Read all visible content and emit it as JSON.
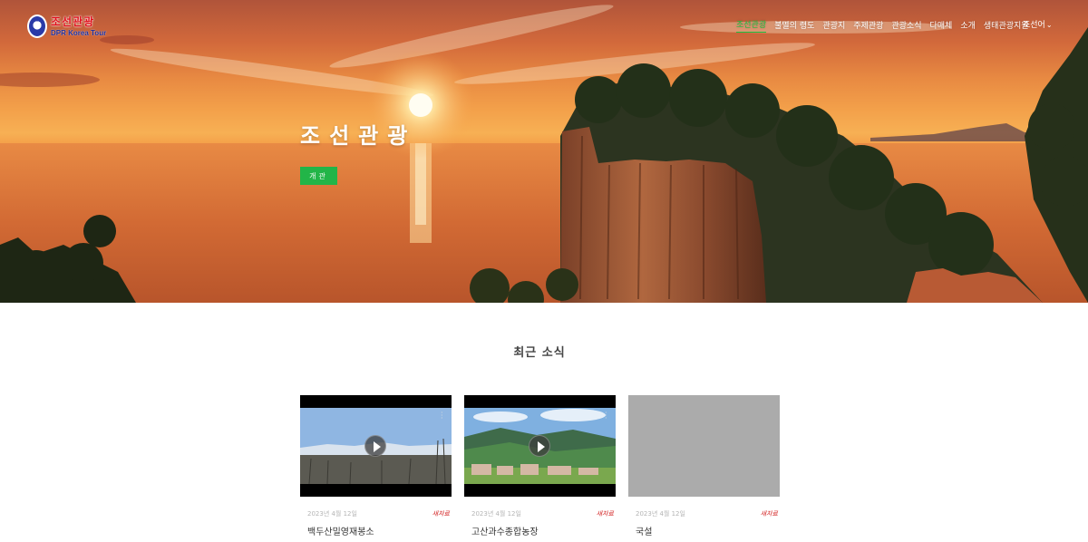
{
  "brand": {
    "logo_korean": "조선관광",
    "logo_english": "DPR Korea Tour"
  },
  "nav": {
    "items": [
      {
        "label": "조선관광",
        "active": true
      },
      {
        "label": "불멸의 령도",
        "active": false
      },
      {
        "label": "관광지",
        "active": false
      },
      {
        "label": "주제관광",
        "active": false
      },
      {
        "label": "관광소식",
        "active": false
      },
      {
        "label": "다매체",
        "active": false
      },
      {
        "label": "소개",
        "active": false
      },
      {
        "label": "생태관광지원",
        "active": false
      }
    ],
    "language": "조선어",
    "active_color": "#1fbf3f"
  },
  "hero": {
    "title": "조선관광",
    "button_label": "개관",
    "button_color": "#22b548"
  },
  "news": {
    "section_title": "최근 소식",
    "cards": [
      {
        "date": "2023년 4월 12일",
        "badge": "새자료",
        "title": "백두산밀영재봉소",
        "media": "video",
        "icon": "play-icon"
      },
      {
        "date": "2023년 4월 12일",
        "badge": "새자료",
        "title": "고산과수종합농장",
        "media": "video",
        "icon": "play-icon"
      },
      {
        "date": "2023년 4월 12일",
        "badge": "새자료",
        "title": "국설",
        "media": "placeholder"
      }
    ],
    "badge_color": "#d22020"
  }
}
